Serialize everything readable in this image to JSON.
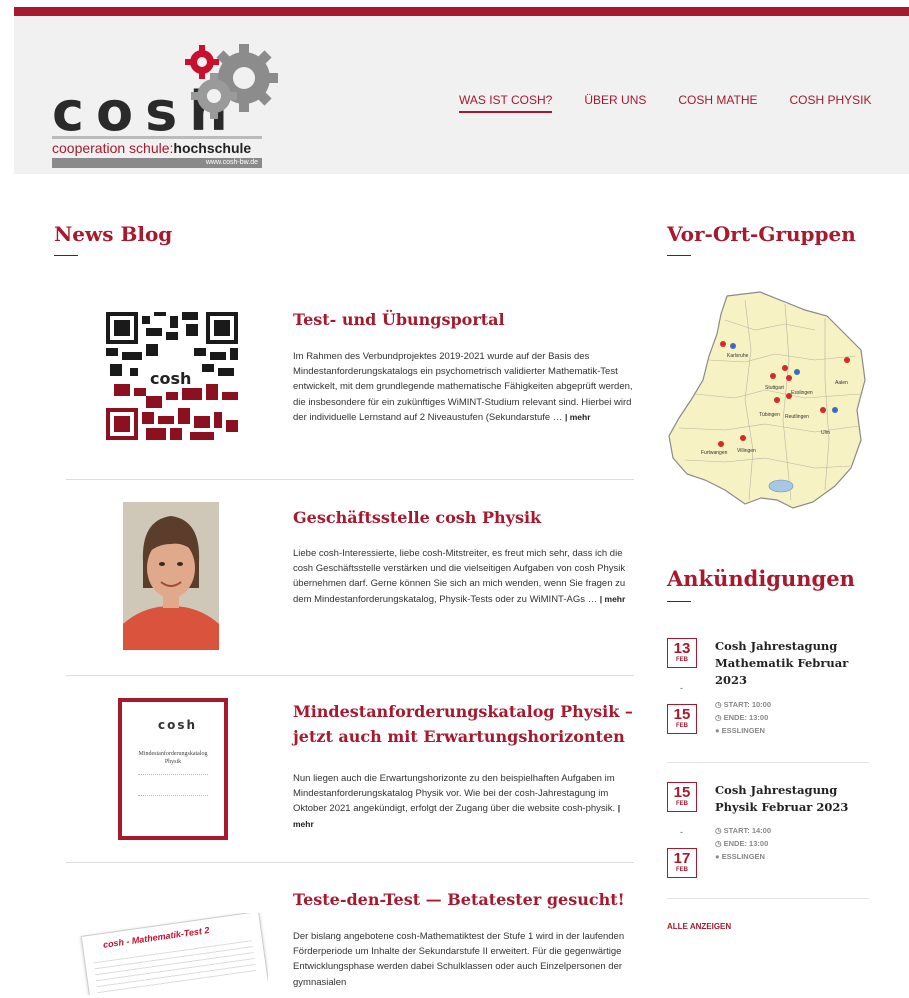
{
  "header": {
    "logo_letters": "cosh",
    "logo_tagline_part1": "cooperation schule:",
    "logo_tagline_part2": "hochschule",
    "logo_url": "www.cosh-bw.de",
    "brand_color": "#a8192e",
    "nav": [
      {
        "label": "WAS IST COSH?",
        "active": true
      },
      {
        "label": "ÜBER UNS",
        "active": false
      },
      {
        "label": "COSH MATHE",
        "active": false
      },
      {
        "label": "COSH PHYSIK",
        "active": false
      }
    ]
  },
  "news": {
    "title": "News Blog",
    "posts": [
      {
        "title": "Test- und Übungsportal",
        "excerpt": "Im Rahmen des Verbundprojektes 2019-2021 wurde auf der Basis des Mindestanforderungskatalogs ein psychometrisch validierter Mathematik-Test entwickelt, mit dem grundlegende mathematische Fähigkeiten abgeprüft werden, die insbesondere für ein zukünftiges WiMINT-Studium relevant sind. Hierbei wird der individuelle Lernstand auf 2 Niveaustufen (Sekundarstufe … ",
        "more": "| mehr",
        "thumb": "qr-code"
      },
      {
        "title": "Geschäftsstelle cosh Physik",
        "excerpt": "Liebe cosh-Interessierte, liebe cosh-Mitstreiter, es freut mich sehr, dass ich die cosh Geschäftsstelle verstärken und die vielseitigen Aufgaben von cosh Physik übernehmen darf. Gerne können Sie sich an mich wenden, wenn Sie fragen zu dem Mindestanforderungskatalog, Physik-Tests oder zu WiMINT-AGs … ",
        "more": "| mehr",
        "thumb": "portrait-photo"
      },
      {
        "title": "Mindestanforderungskatalog Physik – jetzt auch mit Erwartungshorizonten",
        "excerpt": "Nun liegen auch die Erwartungshorizonte zu den beispielhaften Aufgaben im Mindestanforderungskatalog Physik vor. Wie bei der cosh-Jahrestagung im Oktober 2021 angekündigt, erfolgt der Zugang über die website cosh-physik. ",
        "more": "| mehr",
        "thumb": "document-cover",
        "cover_title": "Mindestanforderungskatalog Physik"
      },
      {
        "title": "Teste-den-Test — Betatester gesucht!",
        "excerpt": "Der bislang angebotene cosh-Mathematiktest der Stufe 1 wird in der laufenden Förderperiode um Inhalte der Sekundarstufe II erweitert. Für die gegenwärtige Entwicklungsphase werden dabei Schulklassen oder auch Einzelpersonen der gymnasialen",
        "more": "",
        "thumb": "test-sheet",
        "sheet_title": "cosh - Mathematik-Test 2"
      }
    ]
  },
  "groups": {
    "title": "Vor-Ort-Gruppen",
    "map_labels": [
      "Karlsruhe",
      "Stuttgart",
      "Esslingen",
      "Aalen",
      "Tübingen",
      "Reutlingen",
      "Ulm",
      "Furtwangen",
      "Villingen"
    ]
  },
  "announcements": {
    "title": "Ankündigungen",
    "events": [
      {
        "start_day": "13",
        "start_month": "FEB",
        "end_day": "15",
        "end_month": "FEB",
        "title": "Cosh Jahrestagung Mathematik Februar 2023",
        "start": "START: 10:00",
        "end": "ENDE: 13:00",
        "location": "ESSLINGEN"
      },
      {
        "start_day": "15",
        "start_month": "FEB",
        "end_day": "17",
        "end_month": "FEB",
        "title": "Cosh Jahrestagung Physik Februar 2023",
        "start": "START: 14:00",
        "end": "ENDE: 13:00",
        "location": "ESSLINGEN"
      }
    ],
    "all_label": "ALLE ANZEIGEN"
  }
}
